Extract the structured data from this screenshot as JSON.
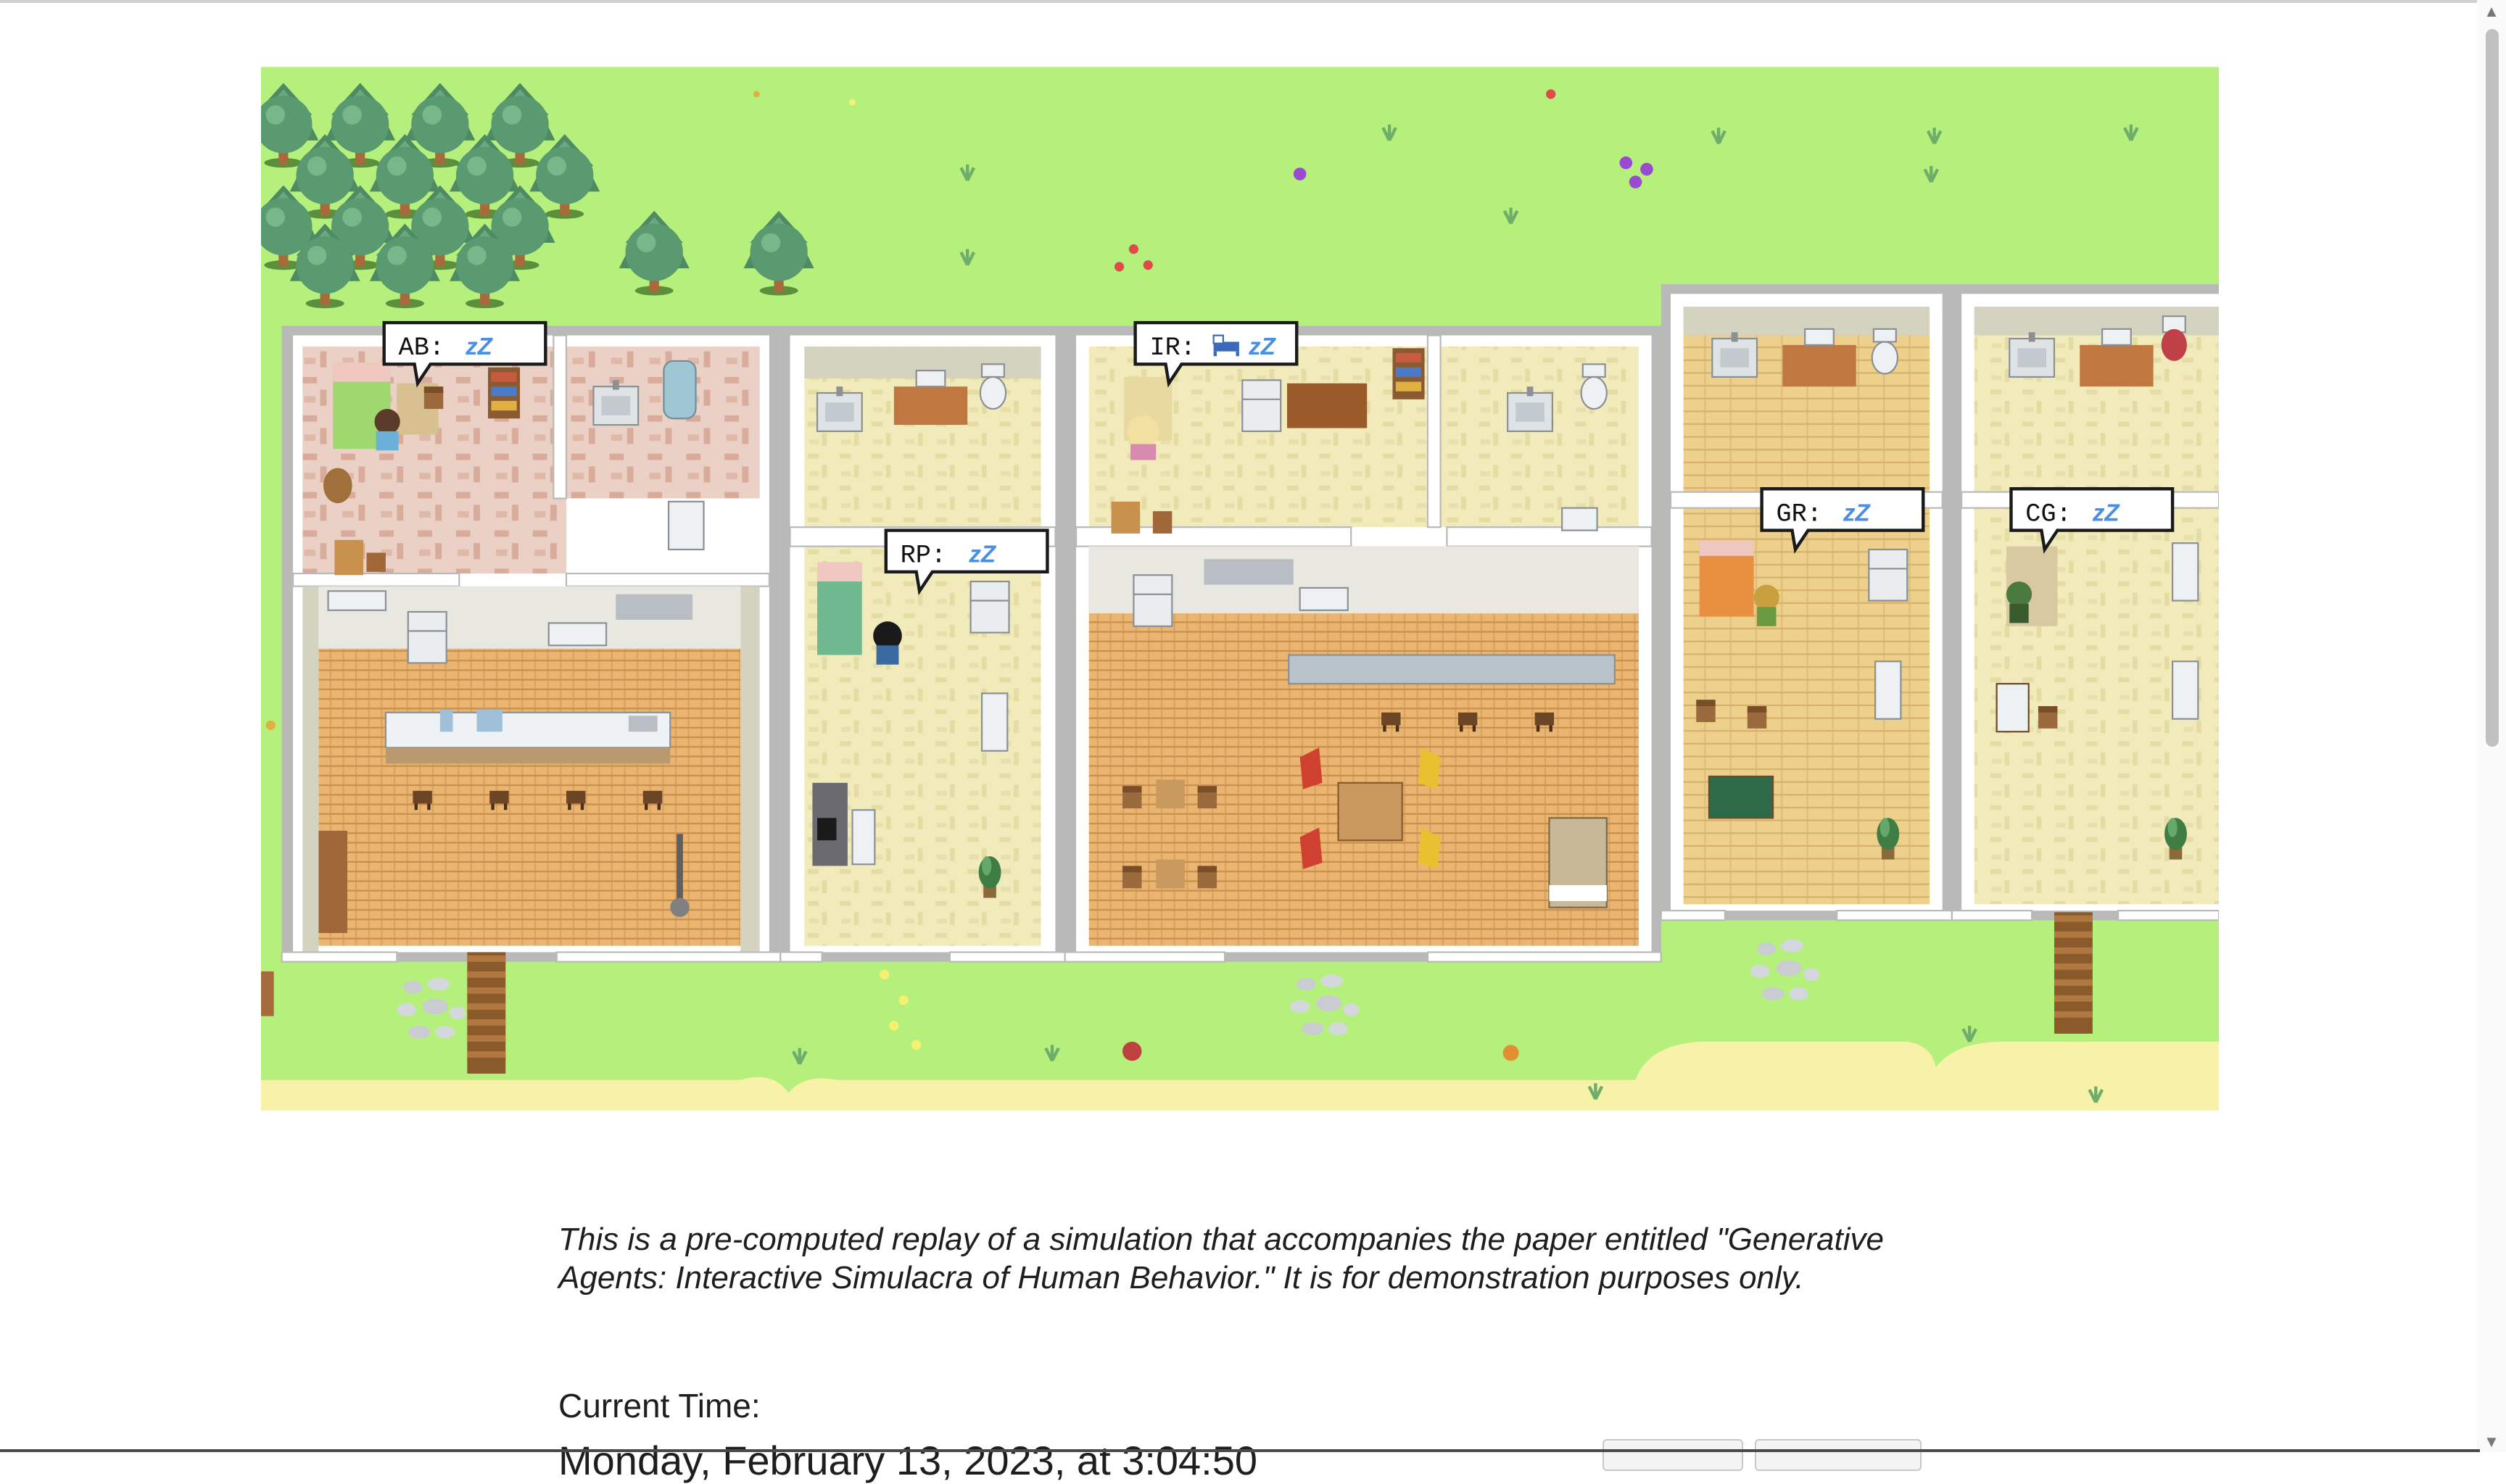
{
  "game": {
    "agents": [
      {
        "label": "AB:",
        "status_icon": "zzz-icon",
        "status": "zZ"
      },
      {
        "label": "IR:",
        "status_icon": "bed-icon",
        "status": "zZ"
      },
      {
        "label": "RP:",
        "status_icon": "zzz-icon",
        "status": "zZ"
      },
      {
        "label": "GR:",
        "status_icon": "zzz-icon",
        "status": "zZ"
      },
      {
        "label": "CG:",
        "status_icon": "zzz-icon",
        "status": "zZ"
      }
    ],
    "colors": {
      "grass": "#b6f07c",
      "sand": "#f7f2a8",
      "wood_floor": "#e9b571",
      "tile_floor": "#efe8b4",
      "pink_floor": "#e9c7bb",
      "wall": "#ffffff",
      "zzz": "#4a90e2"
    }
  },
  "description": "This is a pre-computed replay of a simulation that accompanies the paper entitled \"Generative Agents: Interactive Simulacra of Human Behavior.\" It is for demonstration purposes only.",
  "time": {
    "label": "Current Time:",
    "value": "Monday, February 13, 2023, at 3:04:50"
  }
}
